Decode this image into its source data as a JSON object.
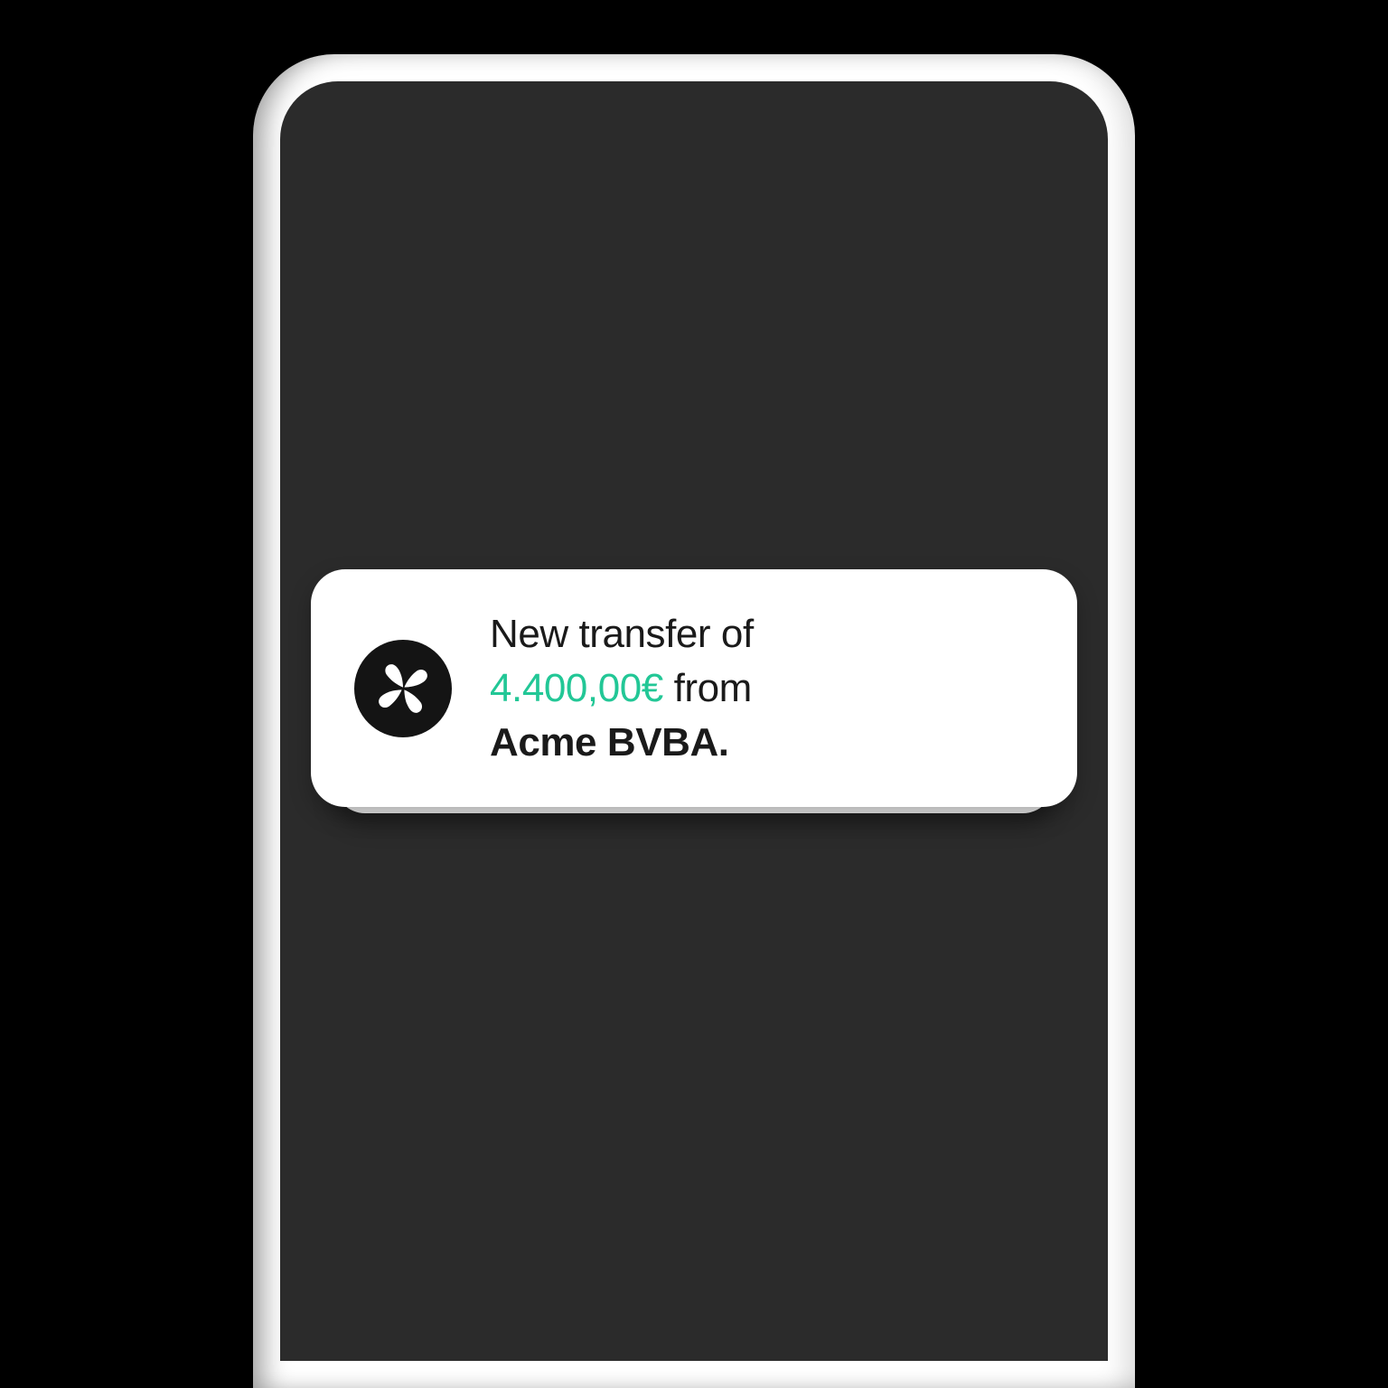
{
  "notification": {
    "prefix": "New transfer of",
    "amount": "4.400,00€",
    "middle": " from",
    "sender": "Acme BVBA.",
    "icon_name": "flower-petal-icon"
  },
  "colors": {
    "amount": "#22c796",
    "text": "#1a1a1a",
    "card_bg": "#ffffff",
    "screen_bg": "#2b2b2b",
    "icon_bg": "#141414"
  }
}
